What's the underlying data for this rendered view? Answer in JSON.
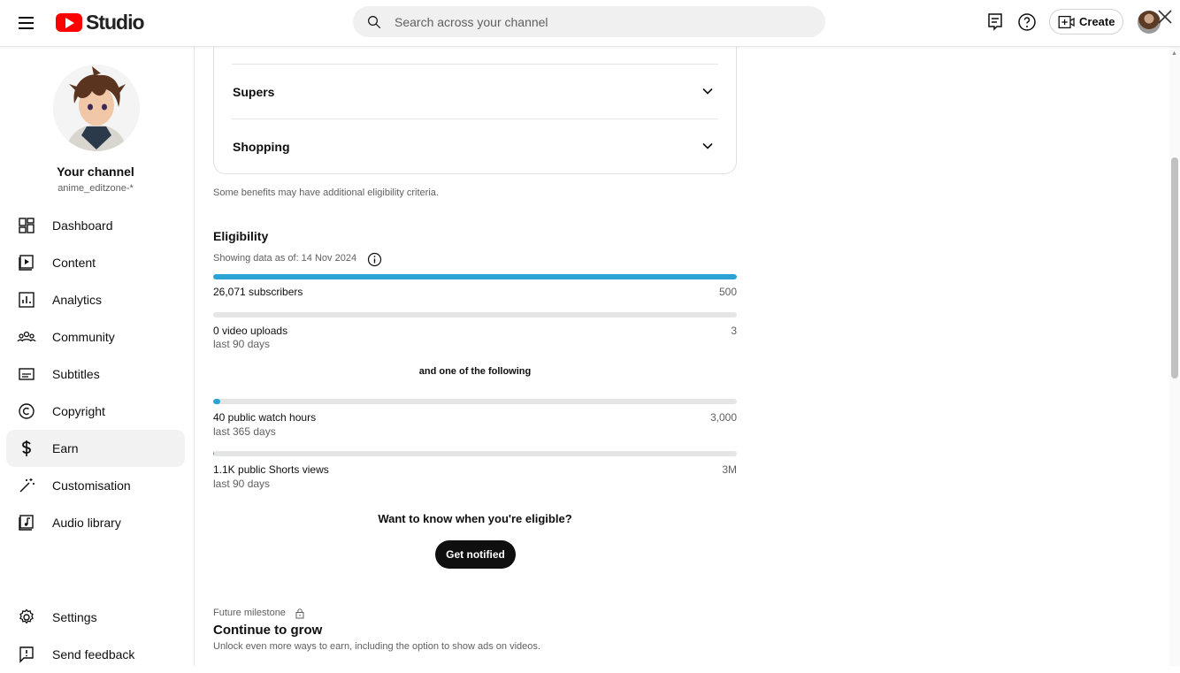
{
  "header": {
    "logo_text": "Studio",
    "search_placeholder": "Search across your channel",
    "create_label": "Create"
  },
  "sidebar": {
    "channel_title": "Your channel",
    "channel_handle": "anime_editzone-*",
    "items": [
      {
        "label": "Dashboard",
        "icon": "dashboard-icon"
      },
      {
        "label": "Content",
        "icon": "content-icon"
      },
      {
        "label": "Analytics",
        "icon": "analytics-icon"
      },
      {
        "label": "Community",
        "icon": "community-icon"
      },
      {
        "label": "Subtitles",
        "icon": "subtitles-icon"
      },
      {
        "label": "Copyright",
        "icon": "copyright-icon"
      },
      {
        "label": "Earn",
        "icon": "dollar-icon",
        "active": true
      },
      {
        "label": "Customisation",
        "icon": "magic-wand-icon"
      },
      {
        "label": "Audio library",
        "icon": "audio-library-icon"
      }
    ],
    "bottom_items": [
      {
        "label": "Settings",
        "icon": "gear-icon"
      },
      {
        "label": "Send feedback",
        "icon": "feedback-icon"
      }
    ]
  },
  "main": {
    "accordions": [
      {
        "label": "Supers"
      },
      {
        "label": "Shopping"
      }
    ],
    "note": "Some benefits may have additional eligibility criteria.",
    "eligibility": {
      "title": "Eligibility",
      "showing": "Showing data as of: 14 Nov 2024",
      "requirements": [
        {
          "label": "26,071 subscribers",
          "sub": "",
          "target": "500",
          "progress": 1.0
        },
        {
          "label": "0 video uploads",
          "sub": "last 90 days",
          "target": "3",
          "progress": 0.0
        }
      ],
      "and_one": "and one of the following",
      "optional": [
        {
          "label": "40 public watch hours",
          "sub": "last 365 days",
          "target": "3,000",
          "progress": 0.013
        },
        {
          "label": "1.1K public Shorts views",
          "sub": "last 90 days",
          "target": "3M",
          "progress": 0.0004
        }
      ],
      "want_text": "Want to know when you're eligible?",
      "notify_label": "Get notified"
    },
    "future": {
      "label": "Future milestone",
      "title": "Continue to grow",
      "desc": "Unlock even more ways to earn, including the option to show ads on videos."
    }
  },
  "colors": {
    "accent": "#2ba3d4",
    "brand_red": "#ff0000"
  }
}
